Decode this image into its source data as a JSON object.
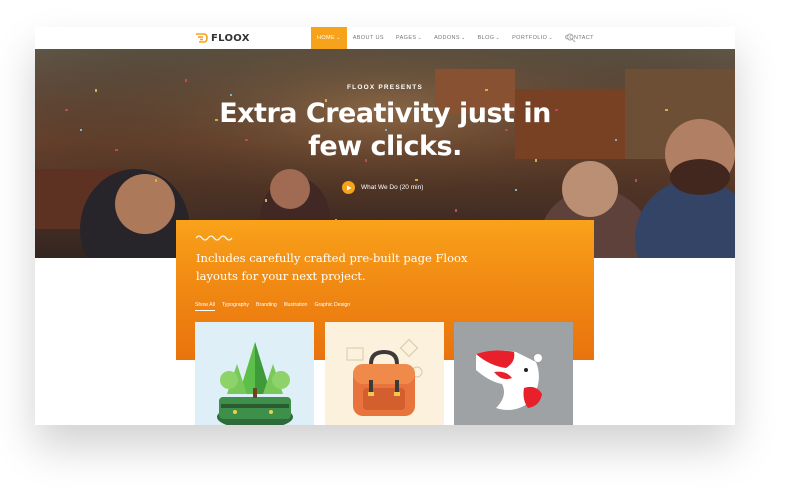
{
  "brand": {
    "name": "FLOOX",
    "accent": "#f7a21b"
  },
  "nav": {
    "items": [
      {
        "label": "HOME",
        "chevron": true,
        "active": true
      },
      {
        "label": "ABOUT US",
        "chevron": false,
        "active": false
      },
      {
        "label": "PAGES",
        "chevron": true,
        "active": false
      },
      {
        "label": "ADDONS",
        "chevron": true,
        "active": false
      },
      {
        "label": "BLOG",
        "chevron": true,
        "active": false
      },
      {
        "label": "PORTFOLIO",
        "chevron": true,
        "active": false
      },
      {
        "label": "CONTACT",
        "chevron": false,
        "active": false
      }
    ],
    "search_icon": "search-icon"
  },
  "hero": {
    "eyebrow": "FLOOX PRESENTS",
    "headline_line1": "Extra Creativity just in",
    "headline_line2": "few clicks.",
    "video_label": "What We Do (20 min)",
    "video_icon": "play-icon"
  },
  "intro": {
    "line1": "Includes carefully crafted pre-built page Floox",
    "line2": "layouts for your next project."
  },
  "filters": [
    "Show All",
    "Typography",
    "Branding",
    "Illustration",
    "Graphic Design"
  ],
  "portfolio": [
    "forest-illustration",
    "backpack-illustration",
    "rooster-illustration"
  ]
}
